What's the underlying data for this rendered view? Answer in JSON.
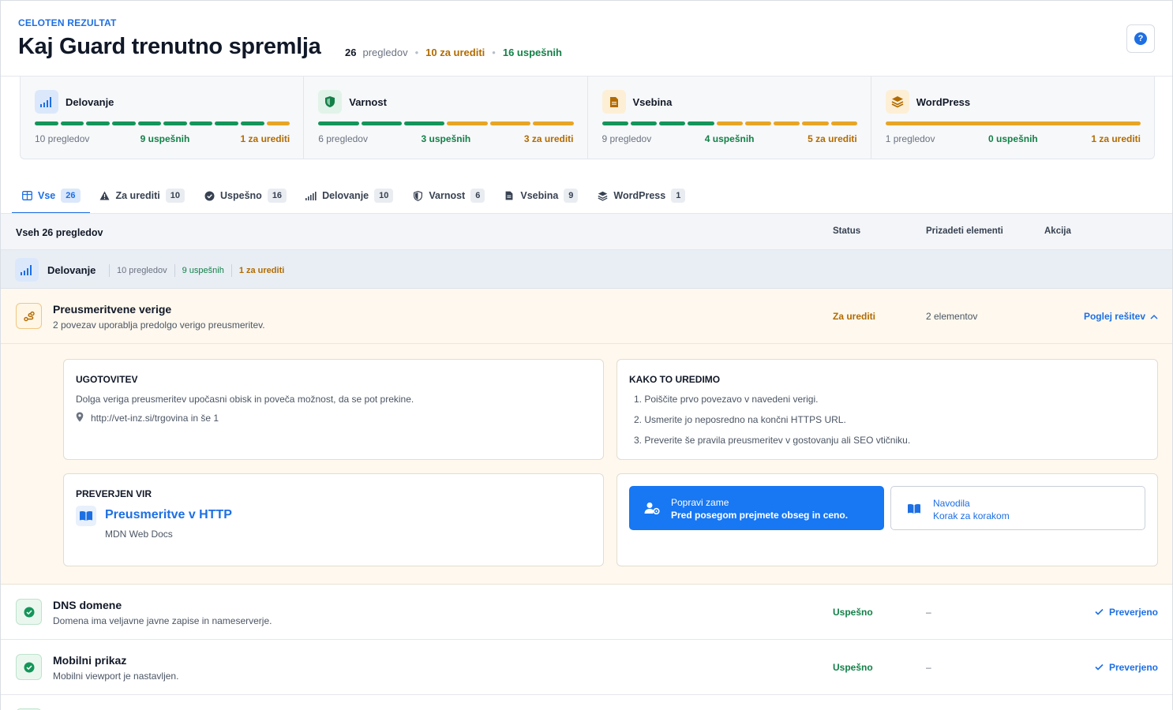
{
  "header": {
    "kicker": "CELOTEN REZULTAT",
    "title": "Kaj Guard trenutno spremlja",
    "stats": {
      "total": "26",
      "total_label": "pregledov",
      "to_fix": "10 za urediti",
      "passed": "16 uspešnih"
    },
    "help_label": "?"
  },
  "cards": [
    {
      "name": "Delovanje",
      "checks": "10 pregledov",
      "passed": "9 uspešnih",
      "to_fix": "1 za urediti",
      "bars": [
        "g",
        "g",
        "g",
        "g",
        "g",
        "g",
        "g",
        "g",
        "g",
        "y"
      ],
      "icon": "signal-bars-icon"
    },
    {
      "name": "Varnost",
      "checks": "6 pregledov",
      "passed": "3 uspešnih",
      "to_fix": "3 za urediti",
      "bars": [
        "g",
        "g",
        "g",
        "y",
        "y",
        "y"
      ],
      "icon": "shield-icon"
    },
    {
      "name": "Vsebina",
      "checks": "9 pregledov",
      "passed": "4 uspešnih",
      "to_fix": "5 za urediti",
      "bars": [
        "g",
        "g",
        "g",
        "g",
        "y",
        "y",
        "y",
        "y",
        "y"
      ],
      "icon": "document-icon"
    },
    {
      "name": "WordPress",
      "checks": "1 pregledov",
      "passed": "0 uspešnih",
      "to_fix": "1 za urediti",
      "bars": [
        "y"
      ],
      "icon": "layers-icon"
    }
  ],
  "tabs": [
    {
      "label": "Vse",
      "count": "26",
      "icon": "grid-icon"
    },
    {
      "label": "Za urediti",
      "count": "10",
      "icon": "warning-icon"
    },
    {
      "label": "Uspešno",
      "count": "16",
      "icon": "check-circle-icon"
    },
    {
      "label": "Delovanje",
      "count": "10",
      "icon": "signal-bars-icon"
    },
    {
      "label": "Varnost",
      "count": "6",
      "icon": "shield-icon"
    },
    {
      "label": "Vsebina",
      "count": "9",
      "icon": "document-icon"
    },
    {
      "label": "WordPress",
      "count": "1",
      "icon": "layers-icon"
    }
  ],
  "table": {
    "title": "Vseh 26 pregledov",
    "col_status": "Status",
    "col_elements": "Prizadeti elementi",
    "col_action": "Akcija"
  },
  "group": {
    "name": "Delovanje",
    "checks": "10 pregledov",
    "passed": "9 uspešnih",
    "to_fix": "1 za urediti"
  },
  "open_item": {
    "title": "Preusmeritvene verige",
    "desc": "2 povezav uporablja predolgo verigo preusmeritev.",
    "status": "Za urediti",
    "elements": "2 elementov",
    "action": "Poglej rešitev",
    "finding": {
      "heading": "UGOTOVITEV",
      "text": "Dolga veriga preusmeritev upočasni obisk in poveča možnost, da se pot prekine.",
      "location": "http://vet-inz.si/trgovina in še 1"
    },
    "fix": {
      "heading": "KAKO TO UREDIMO",
      "steps": [
        "1. Poiščite prvo povezavo v navedeni verigi.",
        "2. Usmerite jo neposredno na končni HTTPS URL.",
        "3. Preverite še pravila preusmeritev v gostovanju ali SEO vtičniku."
      ]
    },
    "source": {
      "heading": "PREVERJEN VIR",
      "title": "Preusmeritve v HTTP",
      "subtitle": "MDN Web Docs"
    },
    "buttons": {
      "primary_title": "Popravi zame",
      "primary_sub": "Pred posegom prejmete obseg in ceno.",
      "secondary_title": "Navodila",
      "secondary_sub": "Korak za korakom"
    }
  },
  "rows": [
    {
      "title": "DNS domene",
      "desc": "Domena ima veljavne javne zapise in nameserverje.",
      "status": "Uspešno",
      "elements": "–",
      "action": "Preverjeno"
    },
    {
      "title": "Mobilni prikaz",
      "desc": "Mobilni viewport je nastavljen.",
      "status": "Uspešno",
      "elements": "–",
      "action": "Preverjeno"
    }
  ],
  "colors": {
    "accent": "#1d6fe3",
    "success": "#138048",
    "warning": "#b26b00",
    "bar_green": "#14955a",
    "bar_yellow": "#e8a525"
  }
}
